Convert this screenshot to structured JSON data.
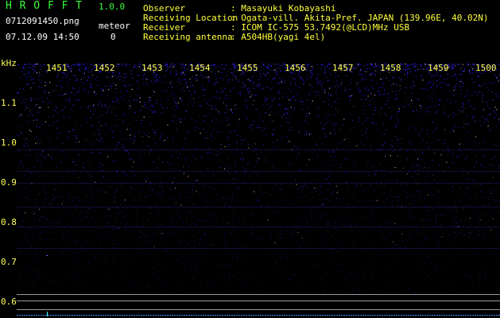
{
  "app": {
    "title": "H R O F F T",
    "version": "1.0.0",
    "filename": "0712091450.png",
    "timestamp": "07.12.09 14:50",
    "meteor_label": "meteor",
    "meteor_count": "0"
  },
  "info": {
    "labels": [
      "Observer",
      "Receiving Location",
      "Receiver",
      "Receiving antenna"
    ],
    "values": [
      ": Masayuki Kobayashi",
      ": Ogata-vill. Akita-Pref. JAPAN (139.96E, 40.02N)",
      ": ICOM IC-575 53.7492(@LCD)MHz USB",
      ": A504HB(yagi 4el)"
    ]
  },
  "spectrogram": {
    "unit": "kHz",
    "time_ticks": [
      "1451",
      "1452",
      "1453",
      "1454",
      "1455",
      "1456",
      "1457",
      "1458",
      "1459",
      "1500"
    ],
    "freq_ticks": [
      "1.1",
      "1.0",
      "0.9",
      "0.8",
      "0.7",
      "0.6"
    ],
    "colors": {
      "signal": "#3c3cff",
      "background": "#000000",
      "axis_text": "#ffff5a"
    }
  }
}
